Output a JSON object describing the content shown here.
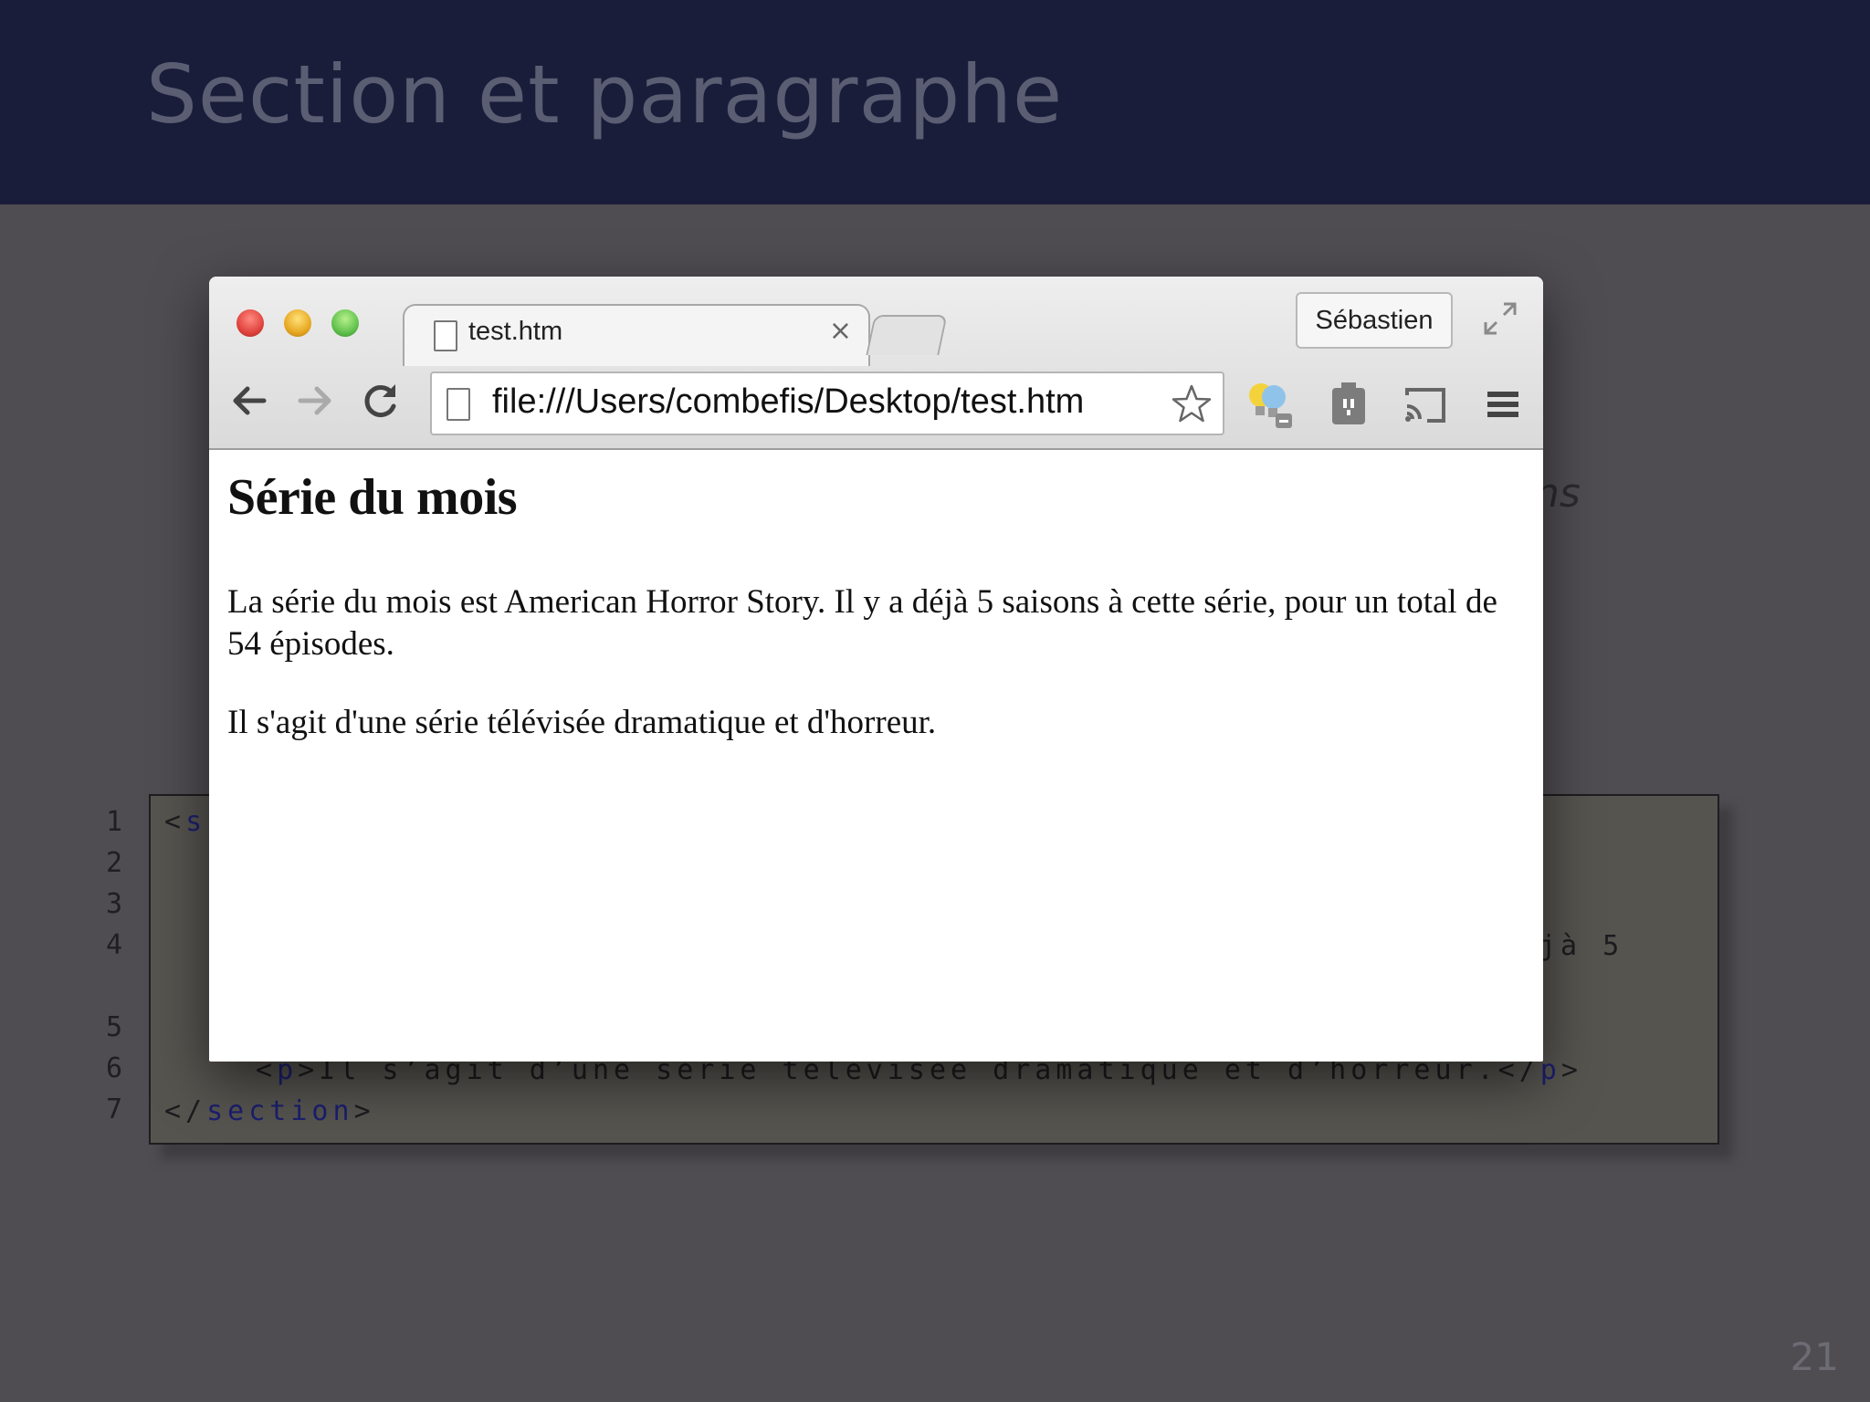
{
  "slide": {
    "title": "Section et paragraphe",
    "italic_fragment": "ns",
    "page_number": "21"
  },
  "code": {
    "line_numbers": [
      "1",
      "2",
      "3",
      "4",
      "5",
      "6",
      "7"
    ],
    "line1_open": "<",
    "line1_tag": "s",
    "line4_fragment": "jà 5",
    "line6_open": "<",
    "line6_tag": "p",
    "line6_mid": ">Il s’agit d’une série télévisée dramatique et d’horreur.</",
    "line6_tag_close": "p",
    "line6_end": ">",
    "line7_open": "</",
    "line7_tag": "section",
    "line7_end": ">"
  },
  "browser": {
    "tab_title": "test.htm",
    "tab_close": "×",
    "profile_name": "Sébastien",
    "url": "file:///Users/combefis/Desktop/test.htm",
    "icons": [
      "back-arrow-icon",
      "forward-arrow-icon",
      "reload-icon",
      "page-icon",
      "star-icon",
      "lightbulb-extension-icon",
      "evernote-extension-icon",
      "cast-icon",
      "menu-icon",
      "fullscreen-icon"
    ],
    "colors": {
      "close": "#e0443e",
      "minimize": "#e8a823",
      "zoom": "#62c24d"
    }
  },
  "page": {
    "heading": "Série du mois",
    "paragraph1": "La série du mois est American Horror Story. Il y a déjà 5 saisons à cette série, pour un total de 54 épisodes.",
    "paragraph2": "Il s'agit d'une série télévisée dramatique et d'horreur."
  }
}
